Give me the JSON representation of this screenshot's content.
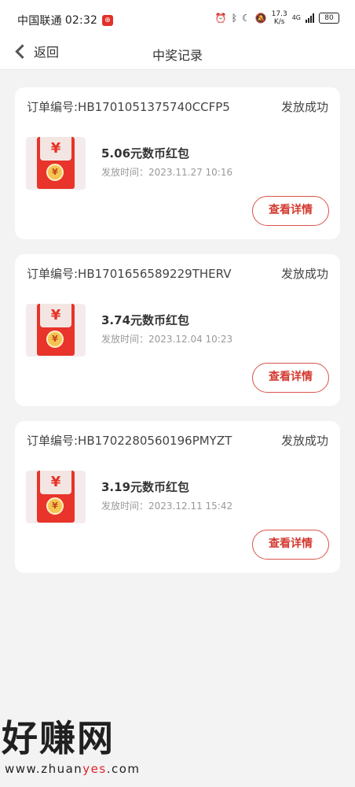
{
  "status_bar": {
    "carrier": "中国联通",
    "time": "02:32",
    "net_speed_top": "17.3",
    "net_speed_bottom": "K/s",
    "network": "4G",
    "battery": "80"
  },
  "nav": {
    "back_label": "返回",
    "title": "中奖记录"
  },
  "records": [
    {
      "order_label": "订单编号:HB1701051375740CCFP5",
      "status": "发放成功",
      "prize": "5.06元数币红包",
      "issue_time": "发放时间：2023.11.27 10:16",
      "detail_label": "查看详情"
    },
    {
      "order_label": "订单编号:HB1701656589229THERV",
      "status": "发放成功",
      "prize": "3.74元数币红包",
      "issue_time": "发放时间：2023.12.04 10:23",
      "detail_label": "查看详情"
    },
    {
      "order_label": "订单编号:HB1702280560196PMYZT",
      "status": "发放成功",
      "prize": "3.19元数币红包",
      "issue_time": "发放时间：2023.12.11 15:42",
      "detail_label": "查看详情"
    }
  ],
  "watermark": {
    "brand": "好赚网",
    "url_prefix": "www.zhuan",
    "url_highlight": "yes",
    "url_suffix": ".com"
  },
  "colors": {
    "accent": "#d43a30",
    "redpacket": "#e8342a",
    "background": "#f3f3f3"
  }
}
